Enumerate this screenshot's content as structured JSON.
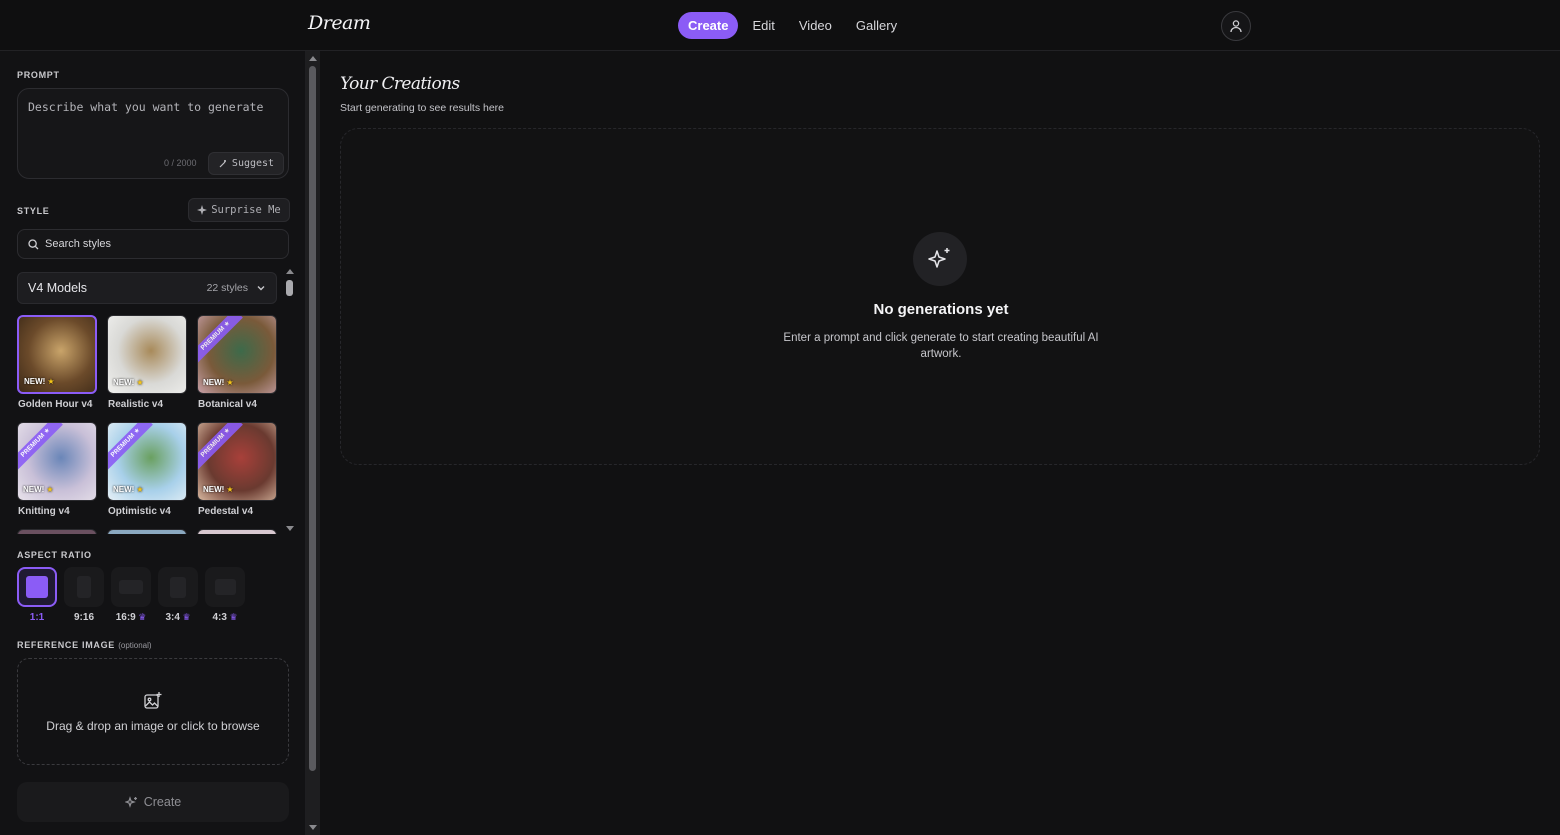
{
  "app": {
    "logo": "Dream"
  },
  "nav": [
    {
      "label": "Create",
      "active": true
    },
    {
      "label": "Edit",
      "active": false
    },
    {
      "label": "Video",
      "active": false
    },
    {
      "label": "Gallery",
      "active": false
    }
  ],
  "sidebar": {
    "prompt": {
      "label": "PROMPT",
      "placeholder": "Describe what you want to generate",
      "char_count": "0 / 2000",
      "suggest_label": "Suggest"
    },
    "style": {
      "label": "STYLE",
      "surprise_label": "Surprise Me",
      "search_placeholder": "Search styles",
      "model_name": "V4 Models",
      "model_count": "22 styles",
      "items": [
        {
          "label": "Golden Hour v4",
          "badge": "NEW!",
          "premium": "",
          "selected": true,
          "colors": [
            "#6b4a2a",
            "#c9a46a",
            "#3d2a18"
          ]
        },
        {
          "label": "Realistic v4",
          "badge": "NEW!",
          "premium": "",
          "selected": false,
          "colors": [
            "#d9d9d6",
            "#a88a5a",
            "#f0f0ee"
          ]
        },
        {
          "label": "Botanical v4",
          "badge": "NEW!",
          "premium": "PREMIUM ★",
          "selected": false,
          "colors": [
            "#7a5a3a",
            "#3d6a4a",
            "#c8a0a8"
          ]
        },
        {
          "label": "Knitting v4",
          "badge": "NEW!",
          "premium": "PREMIUM ★",
          "selected": false,
          "colors": [
            "#c9c0d8",
            "#6a86b8",
            "#e8e2ea"
          ]
        },
        {
          "label": "Optimistic v4",
          "badge": "NEW!",
          "premium": "PREMIUM ★",
          "selected": false,
          "colors": [
            "#a8d0ea",
            "#6aa060",
            "#e6f0f6"
          ]
        },
        {
          "label": "Pedestal v4",
          "badge": "NEW!",
          "premium": "PREMIUM ★",
          "selected": false,
          "colors": [
            "#6a3a30",
            "#a8403a",
            "#d8b8a0"
          ]
        }
      ]
    },
    "aspect_ratio": {
      "label": "ASPECT RATIO",
      "options": [
        {
          "label": "1:1",
          "active": true,
          "crown": false
        },
        {
          "label": "9:16",
          "active": false,
          "crown": false
        },
        {
          "label": "16:9",
          "active": false,
          "crown": true
        },
        {
          "label": "3:4",
          "active": false,
          "crown": true
        },
        {
          "label": "4:3",
          "active": false,
          "crown": true
        }
      ]
    },
    "reference": {
      "label": "REFERENCE IMAGE",
      "optional": "(optional)",
      "drop_text": "Drag & drop an image or click to browse"
    },
    "create_label": "Create"
  },
  "main": {
    "title": "Your Creations",
    "subtitle": "Start generating to see results here",
    "empty_title": "No generations yet",
    "empty_desc": "Enter a prompt and click generate to start creating beautiful AI artwork."
  }
}
